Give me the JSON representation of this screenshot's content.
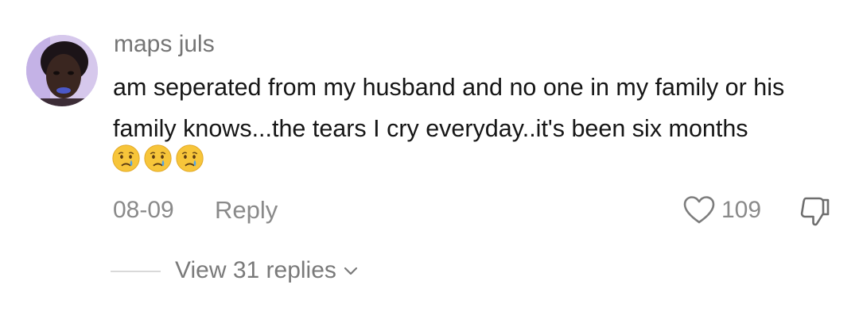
{
  "comment": {
    "username": "maps juls",
    "text_lines": [
      "am seperated from my husband and no one in my family or his",
      "family knows...the tears I cry everyday..it's been six months"
    ],
    "emojis": [
      "crying-face-icon",
      "crying-face-icon",
      "crying-face-icon"
    ],
    "date": "08-09",
    "reply_label": "Reply",
    "like_count": "109",
    "view_replies_label": "View 31 replies"
  },
  "icons": {
    "like": "heart-outline-icon",
    "dislike": "thumbs-down-icon",
    "expand": "chevron-down-icon"
  },
  "colors": {
    "username": "#757575",
    "body_text": "#161616",
    "meta_text": "#8a8a8a",
    "emoji_face": "#f7c53a",
    "tear": "#4da3e8"
  }
}
